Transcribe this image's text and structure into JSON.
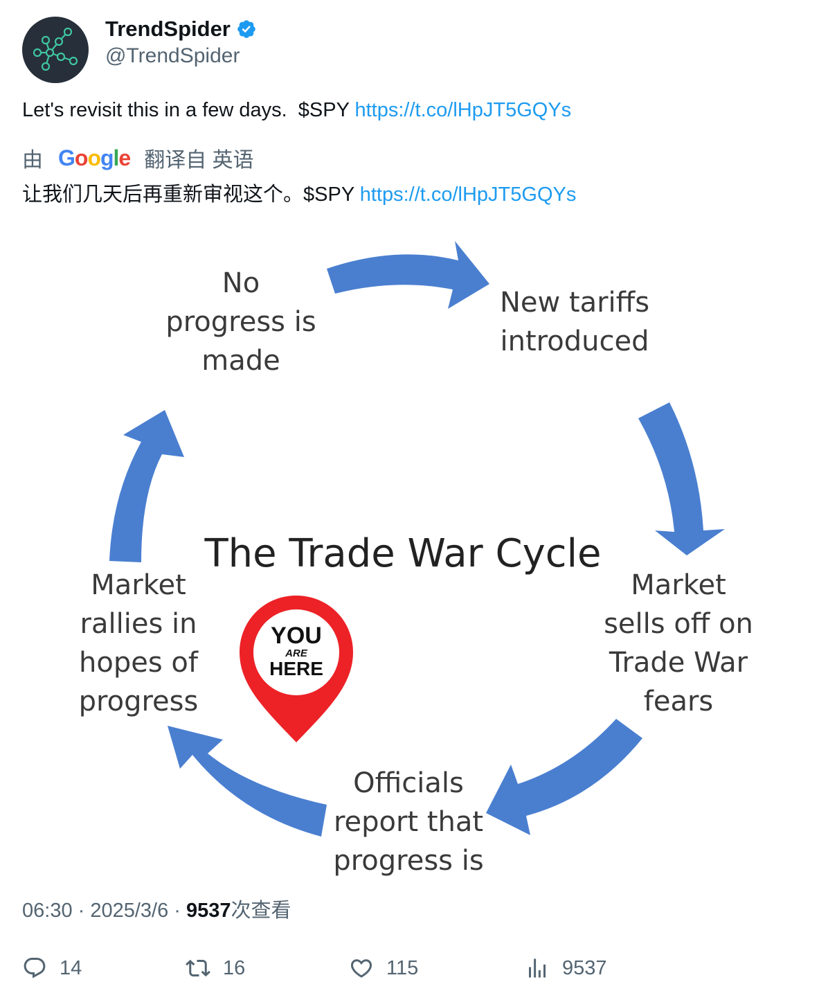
{
  "author": {
    "display_name": "TrendSpider",
    "handle": "@TrendSpider",
    "avatar_icon": "constellation-logo-icon",
    "verified_icon": "verified-badge-icon"
  },
  "tweet": {
    "text": "Let's revisit this in a few days.  $SPY ",
    "link": "https://t.co/lHpJT5GQYs"
  },
  "translation": {
    "prefix": "由",
    "provider": "Google",
    "source_label": "翻译自 英语",
    "text": "让我们几天后再重新审视这个。$SPY ",
    "link": "https://t.co/lHpJT5GQYs"
  },
  "media": {
    "title": "The Trade War Cycle",
    "steps": [
      {
        "id": "no-progress",
        "lines": [
          "No",
          "progress is",
          "made"
        ]
      },
      {
        "id": "new-tariffs",
        "lines": [
          "New tariffs",
          "introduced"
        ]
      },
      {
        "id": "sells-off",
        "lines": [
          "Market",
          "sells off on",
          "Trade War",
          "fears"
        ]
      },
      {
        "id": "officials",
        "lines": [
          "Officials",
          "report that",
          "progress is"
        ]
      },
      {
        "id": "rallies",
        "lines": [
          "Market",
          "rallies in",
          "hopes of",
          "progress"
        ]
      }
    ],
    "pin": {
      "line1": "YOU",
      "line2": "ARE",
      "line3": "HERE"
    },
    "colors": {
      "arrow": "#4a7fd0",
      "pin": "#ec2227"
    }
  },
  "meta": {
    "time": "06:30",
    "sep": " · ",
    "date": "2025/3/6",
    "views_count": "9537",
    "views_label": "次查看"
  },
  "actions": {
    "replies": "14",
    "reposts": "16",
    "likes": "115",
    "views": "9537"
  },
  "colors": {
    "link": "#1d9bf0",
    "text": "#0f1419",
    "secondary": "#536471",
    "verified": "#1d9bf0"
  }
}
